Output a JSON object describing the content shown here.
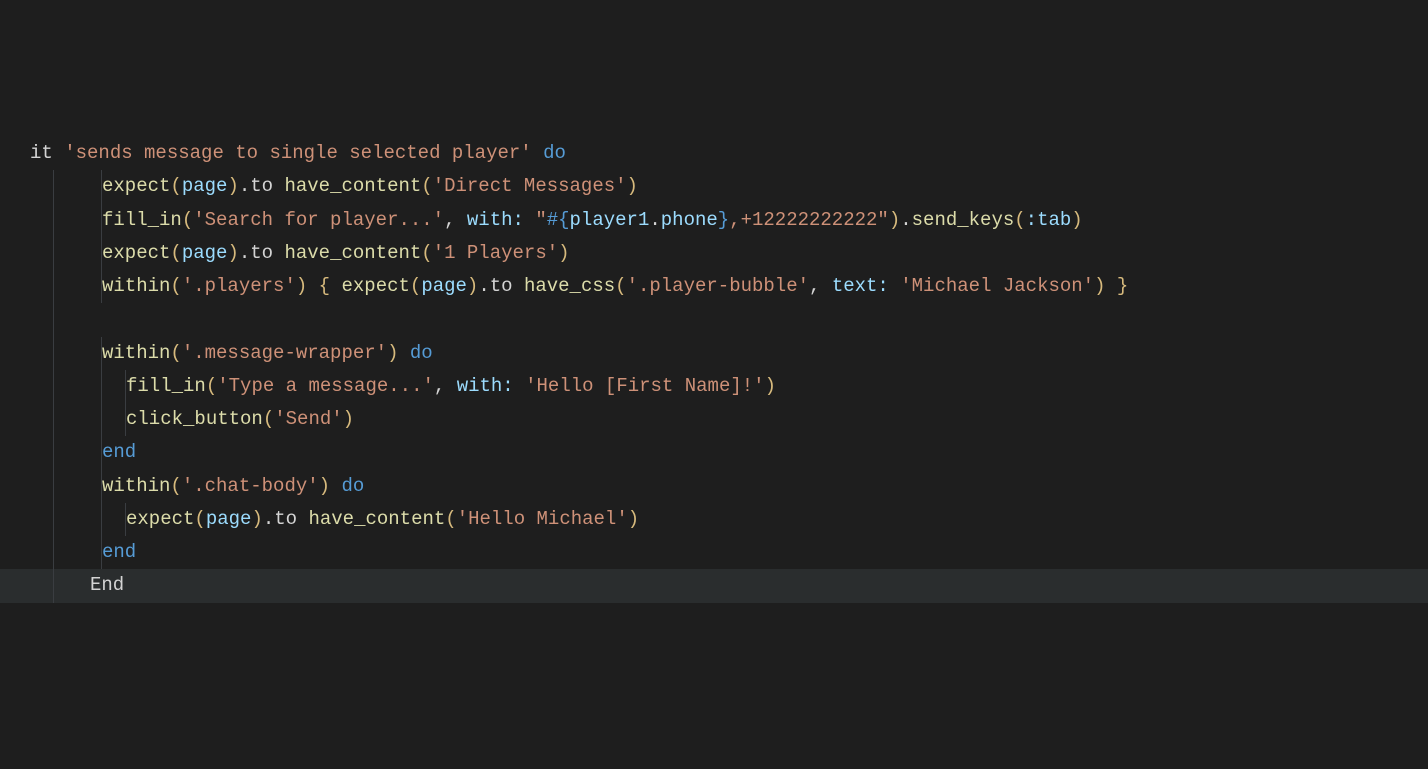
{
  "lines": [
    {
      "indentClass": "ind0",
      "guides": [],
      "hl": false,
      "tokens": [
        {
          "t": "it ",
          "c": "plain"
        },
        {
          "t": "'sends message to single selected player'",
          "c": "str"
        },
        {
          "t": " ",
          "c": "plain"
        },
        {
          "t": "do",
          "c": "kw"
        }
      ]
    },
    {
      "indentClass": "ind8",
      "guides": [
        "g1",
        "g2"
      ],
      "hl": false,
      "tokens": [
        {
          "t": "expect",
          "c": "fn"
        },
        {
          "t": "(",
          "c": "pn"
        },
        {
          "t": "page",
          "c": "var"
        },
        {
          "t": ")",
          "c": "pn"
        },
        {
          "t": ".",
          "c": "op"
        },
        {
          "t": "to",
          "c": "plain"
        },
        {
          "t": " ",
          "c": "plain"
        },
        {
          "t": "have_content",
          "c": "fn"
        },
        {
          "t": "(",
          "c": "pn"
        },
        {
          "t": "'Direct Messages'",
          "c": "str"
        },
        {
          "t": ")",
          "c": "pn"
        }
      ]
    },
    {
      "indentClass": "ind8",
      "guides": [
        "g1",
        "g2"
      ],
      "hl": false,
      "tokens": [
        {
          "t": "fill_in",
          "c": "fn"
        },
        {
          "t": "(",
          "c": "pn"
        },
        {
          "t": "'Search for player...'",
          "c": "str"
        },
        {
          "t": ", ",
          "c": "plain"
        },
        {
          "t": "with:",
          "c": "sym"
        },
        {
          "t": " ",
          "c": "plain"
        },
        {
          "t": "\"",
          "c": "str"
        },
        {
          "t": "#{",
          "c": "interp"
        },
        {
          "t": "player1",
          "c": "var"
        },
        {
          "t": ".",
          "c": "op"
        },
        {
          "t": "phone",
          "c": "var"
        },
        {
          "t": "}",
          "c": "interp"
        },
        {
          "t": ",+12222222222\"",
          "c": "str"
        },
        {
          "t": ")",
          "c": "pn"
        },
        {
          "t": ".",
          "c": "op"
        },
        {
          "t": "send_keys",
          "c": "fn"
        },
        {
          "t": "(",
          "c": "pn"
        },
        {
          "t": ":tab",
          "c": "sym"
        },
        {
          "t": ")",
          "c": "pn"
        }
      ]
    },
    {
      "indentClass": "ind8",
      "guides": [
        "g1",
        "g2"
      ],
      "hl": false,
      "tokens": [
        {
          "t": "expect",
          "c": "fn"
        },
        {
          "t": "(",
          "c": "pn"
        },
        {
          "t": "page",
          "c": "var"
        },
        {
          "t": ")",
          "c": "pn"
        },
        {
          "t": ".",
          "c": "op"
        },
        {
          "t": "to",
          "c": "plain"
        },
        {
          "t": " ",
          "c": "plain"
        },
        {
          "t": "have_content",
          "c": "fn"
        },
        {
          "t": "(",
          "c": "pn"
        },
        {
          "t": "'1 Players'",
          "c": "str"
        },
        {
          "t": ")",
          "c": "pn"
        }
      ]
    },
    {
      "indentClass": "ind8",
      "guides": [
        "g1",
        "g2"
      ],
      "hl": false,
      "tokens": [
        {
          "t": "within",
          "c": "fn"
        },
        {
          "t": "(",
          "c": "pn"
        },
        {
          "t": "'.players'",
          "c": "str"
        },
        {
          "t": ")",
          "c": "pn"
        },
        {
          "t": " ",
          "c": "plain"
        },
        {
          "t": "{",
          "c": "pn"
        },
        {
          "t": " ",
          "c": "plain"
        },
        {
          "t": "expect",
          "c": "fn"
        },
        {
          "t": "(",
          "c": "pn"
        },
        {
          "t": "page",
          "c": "var"
        },
        {
          "t": ")",
          "c": "pn"
        },
        {
          "t": ".",
          "c": "op"
        },
        {
          "t": "to",
          "c": "plain"
        },
        {
          "t": " ",
          "c": "plain"
        },
        {
          "t": "have_css",
          "c": "fn"
        },
        {
          "t": "(",
          "c": "pn"
        },
        {
          "t": "'.player-bubble'",
          "c": "str"
        },
        {
          "t": ", ",
          "c": "plain"
        },
        {
          "t": "text:",
          "c": "sym"
        },
        {
          "t": " ",
          "c": "plain"
        },
        {
          "t": "'Michael Jackson'",
          "c": "str"
        },
        {
          "t": ")",
          "c": "pn"
        },
        {
          "t": " ",
          "c": "plain"
        },
        {
          "t": "}",
          "c": "pn"
        }
      ]
    },
    {
      "indentClass": "ind8",
      "guides": [
        "g1"
      ],
      "hl": false,
      "tokens": [
        {
          "t": " ",
          "c": "plain"
        }
      ]
    },
    {
      "indentClass": "ind8",
      "guides": [
        "g1",
        "g2"
      ],
      "hl": false,
      "tokens": [
        {
          "t": "within",
          "c": "fn"
        },
        {
          "t": "(",
          "c": "pn"
        },
        {
          "t": "'.message-wrapper'",
          "c": "str"
        },
        {
          "t": ")",
          "c": "pn"
        },
        {
          "t": " ",
          "c": "plain"
        },
        {
          "t": "do",
          "c": "kw"
        }
      ]
    },
    {
      "indentClass": "ind10",
      "guides": [
        "g1",
        "g2",
        "g3"
      ],
      "hl": false,
      "tokens": [
        {
          "t": "fill_in",
          "c": "fn"
        },
        {
          "t": "(",
          "c": "pn"
        },
        {
          "t": "'Type a message...'",
          "c": "str"
        },
        {
          "t": ", ",
          "c": "plain"
        },
        {
          "t": "with:",
          "c": "sym"
        },
        {
          "t": " ",
          "c": "plain"
        },
        {
          "t": "'Hello [First Name]!'",
          "c": "str"
        },
        {
          "t": ")",
          "c": "pn"
        }
      ]
    },
    {
      "indentClass": "ind10",
      "guides": [
        "g1",
        "g2",
        "g3"
      ],
      "hl": false,
      "tokens": [
        {
          "t": "click_button",
          "c": "fn"
        },
        {
          "t": "(",
          "c": "pn"
        },
        {
          "t": "'Send'",
          "c": "str"
        },
        {
          "t": ")",
          "c": "pn"
        }
      ]
    },
    {
      "indentClass": "ind8",
      "guides": [
        "g1",
        "g2"
      ],
      "hl": false,
      "tokens": [
        {
          "t": "end",
          "c": "kw"
        }
      ]
    },
    {
      "indentClass": "ind8",
      "guides": [
        "g1",
        "g2"
      ],
      "hl": false,
      "tokens": [
        {
          "t": "within",
          "c": "fn"
        },
        {
          "t": "(",
          "c": "pn"
        },
        {
          "t": "'.chat-body'",
          "c": "str"
        },
        {
          "t": ")",
          "c": "pn"
        },
        {
          "t": " ",
          "c": "plain"
        },
        {
          "t": "do",
          "c": "kw"
        }
      ]
    },
    {
      "indentClass": "ind10",
      "guides": [
        "g1",
        "g2",
        "g3"
      ],
      "hl": false,
      "tokens": [
        {
          "t": "expect",
          "c": "fn"
        },
        {
          "t": "(",
          "c": "pn"
        },
        {
          "t": "page",
          "c": "var"
        },
        {
          "t": ")",
          "c": "pn"
        },
        {
          "t": ".",
          "c": "op"
        },
        {
          "t": "to",
          "c": "plain"
        },
        {
          "t": " ",
          "c": "plain"
        },
        {
          "t": "have_content",
          "c": "fn"
        },
        {
          "t": "(",
          "c": "pn"
        },
        {
          "t": "'Hello Michael'",
          "c": "str"
        },
        {
          "t": ")",
          "c": "pn"
        }
      ]
    },
    {
      "indentClass": "ind8",
      "guides": [
        "g1",
        "g2"
      ],
      "hl": false,
      "tokens": [
        {
          "t": "end",
          "c": "kw"
        }
      ]
    },
    {
      "indentClass": "ind5",
      "guides": [
        "g1"
      ],
      "hl": true,
      "tokens": [
        {
          "t": "End",
          "c": "plain"
        }
      ]
    }
  ]
}
